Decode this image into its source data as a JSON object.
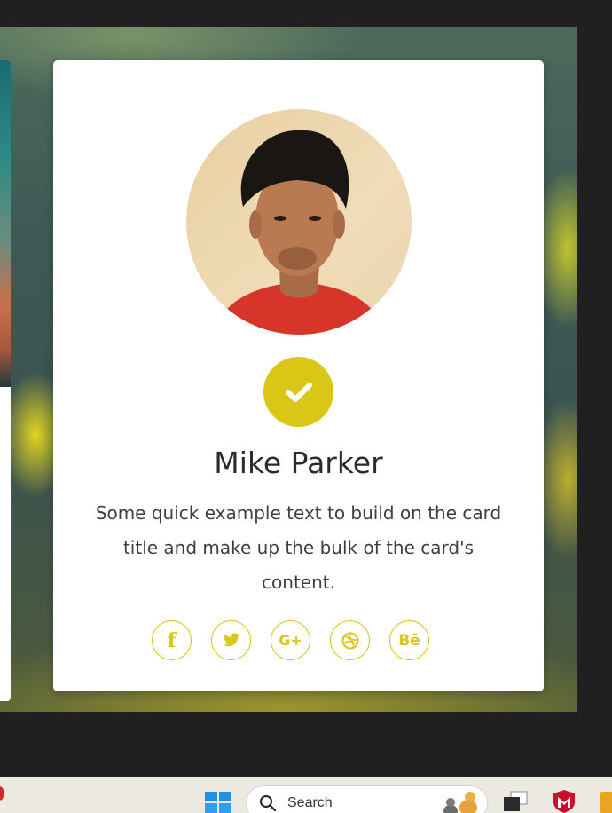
{
  "profile_card": {
    "name": "Mike Parker",
    "description": "Some quick example text to build on the card title and make up the bulk of the card's content.",
    "accent_color": "#d9c617",
    "badge_icon": "check-icon",
    "social_links": [
      {
        "icon": "facebook-icon",
        "glyph": "f"
      },
      {
        "icon": "twitter-icon",
        "glyph": ""
      },
      {
        "icon": "google-plus-icon",
        "glyph": "G+"
      },
      {
        "icon": "dribbble-icon",
        "glyph": ""
      },
      {
        "icon": "behance-icon",
        "glyph": "Bē"
      }
    ]
  },
  "taskbar": {
    "search_placeholder": "Search"
  }
}
